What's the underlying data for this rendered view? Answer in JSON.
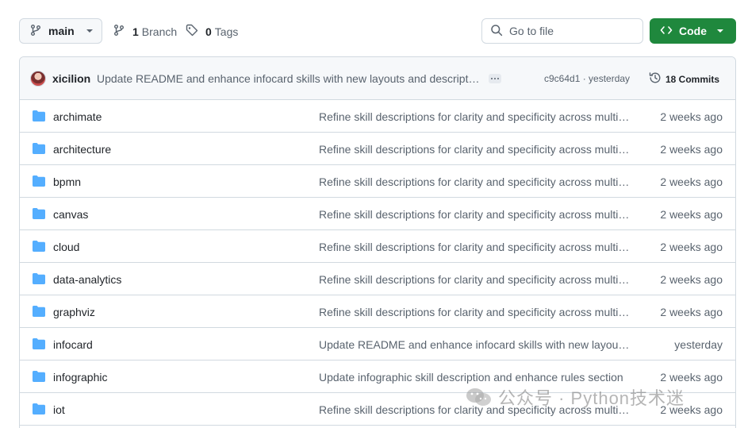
{
  "toolbar": {
    "branch_name": "main",
    "branches": {
      "count": "1",
      "label": "Branch"
    },
    "tags": {
      "count": "0",
      "label": "Tags"
    },
    "search_placeholder": "Go to file",
    "code_label": "Code"
  },
  "commit": {
    "author": "xicilion",
    "message": "Update README and enhance infocard skills with new layouts and descriptions",
    "hash_time": "c9c64d1 · yesterday",
    "commits_label": "18 Commits"
  },
  "files": [
    {
      "name": "archimate",
      "message": "Refine skill descriptions for clarity and specificity across multiple skills",
      "date": "2 weeks ago"
    },
    {
      "name": "architecture",
      "message": "Refine skill descriptions for clarity and specificity across multiple skills",
      "date": "2 weeks ago"
    },
    {
      "name": "bpmn",
      "message": "Refine skill descriptions for clarity and specificity across multiple skills",
      "date": "2 weeks ago"
    },
    {
      "name": "canvas",
      "message": "Refine skill descriptions for clarity and specificity across multiple skills",
      "date": "2 weeks ago"
    },
    {
      "name": "cloud",
      "message": "Refine skill descriptions for clarity and specificity across multiple skills",
      "date": "2 weeks ago"
    },
    {
      "name": "data-analytics",
      "message": "Refine skill descriptions for clarity and specificity across multiple skills",
      "date": "2 weeks ago"
    },
    {
      "name": "graphviz",
      "message": "Refine skill descriptions for clarity and specificity across multiple skills",
      "date": "2 weeks ago"
    },
    {
      "name": "infocard",
      "message": "Update README and enhance infocard skills with new layouts and descriptions",
      "date": "yesterday"
    },
    {
      "name": "infographic",
      "message": "Update infographic skill description and enhance rules section",
      "date": "2 weeks ago"
    },
    {
      "name": "iot",
      "message": "Refine skill descriptions for clarity and specificity across multiple skills",
      "date": "2 weeks ago"
    }
  ],
  "watermark": {
    "text": "公众号 · Python技术迷"
  },
  "colors": {
    "accent_green": "#1f883d",
    "folder_blue": "#54aeff",
    "muted_text": "#59636e",
    "border": "#d1d9e0"
  },
  "icons": [
    "branch-icon",
    "tag-icon",
    "search-icon",
    "code-icon",
    "chevron-down-icon",
    "history-icon",
    "folder-icon",
    "ellipsis-icon"
  ]
}
